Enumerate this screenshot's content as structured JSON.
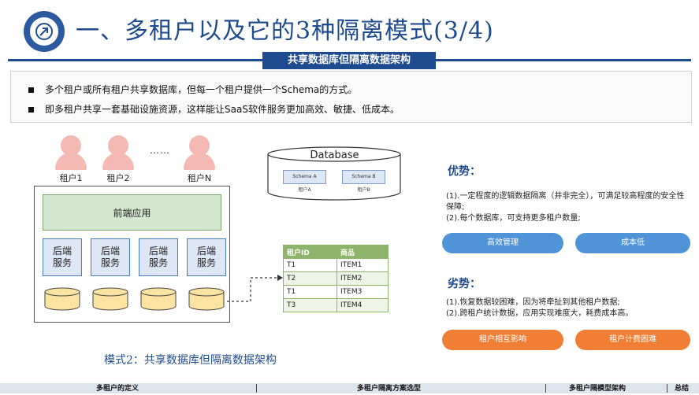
{
  "header": {
    "title": "一、多租户以及它的3种隔离模式(3/4)",
    "banner": "共享数据库但隔离数据架构"
  },
  "bullets": [
    "多个租户或所有租户共享数据库，但每一个租户提供一个Schema的方式。",
    "即多租户共享一套基础设施资源，这样能让SaaS软件服务更加高效、敏捷、低成本。"
  ],
  "diagram": {
    "tenants": [
      "租户1",
      "租户2",
      "租户N"
    ],
    "ellipsis": "……",
    "frontend": "前端应用",
    "services": [
      "后端\n服务",
      "后端\n服务",
      "后端\n服务",
      "后端\n服务"
    ],
    "database": {
      "title": "Database",
      "schemas": [
        {
          "name": "Schema A",
          "owner": "租户A"
        },
        {
          "name": "Schema B",
          "owner": "租户B"
        }
      ]
    },
    "table": {
      "headers": [
        "租户ID",
        "商品"
      ],
      "rows": [
        [
          "T1",
          "ITEM1"
        ],
        [
          "T2",
          "ITEM2"
        ],
        [
          "T1",
          "ITEM3"
        ],
        [
          "T3",
          "ITEM4"
        ]
      ]
    },
    "caption": "模式2：共享数据库但隔离数据架构"
  },
  "advantages": {
    "title": "优势：",
    "lines": [
      "(1).一定程度的逻辑数据隔离（并非完全），可满足较高程度的安全性保障;",
      "(2).每个数据库，可支持更多租户数量;"
    ],
    "pills": [
      "高效管理",
      "成本低"
    ]
  },
  "disadvantages": {
    "title": "劣势：",
    "lines": [
      "(1).恢复数据较困难，因为将牵扯到其他租户数据;",
      "(2).跨租户统计数据，应用实现难度大，耗费成本高。"
    ],
    "pills": [
      "租户相互影响",
      "租户计费困难"
    ]
  },
  "nav": [
    "多租户的定义",
    "多租户隔离方案选型",
    "多租户隔模型架构",
    "总结"
  ],
  "colors": {
    "primary": "#1e4b8f",
    "tenant": "#f4b9b2",
    "frontend": "#d4e8cf",
    "service": "#dce6f4",
    "db": "#fbe3a1",
    "table_header": "#8cb46b",
    "pill_blue": "#4f94d6",
    "pill_orange": "#f07f35"
  }
}
